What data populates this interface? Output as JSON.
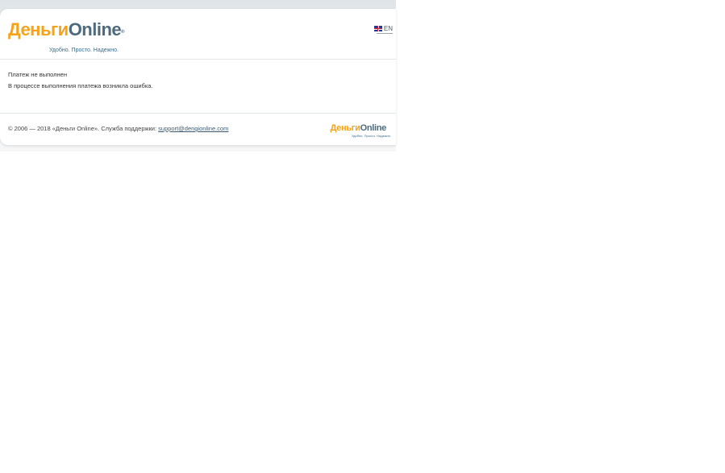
{
  "header": {
    "logo": {
      "part1": "Деньги",
      "part2": "Online",
      "tagline": "Удобно. Просто. Надежно."
    },
    "language": {
      "label": "EN",
      "flag_icon": "uk-flag-icon"
    }
  },
  "message": {
    "title": "Платеж не выполнен",
    "text": "В процессе выполнения платежа возникла ошибка."
  },
  "footer": {
    "copyright_prefix": "© 2006 — 2018 «Деньги Online». Служба поддержки: ",
    "support_email": "support@dengionline.com",
    "logo": {
      "part1": "Деньги",
      "part2": "Online",
      "tagline": "Удобно. Просто. Надежно."
    }
  },
  "colors": {
    "brand_orange": "#f5a31a",
    "brand_slate": "#4d6b7c"
  }
}
